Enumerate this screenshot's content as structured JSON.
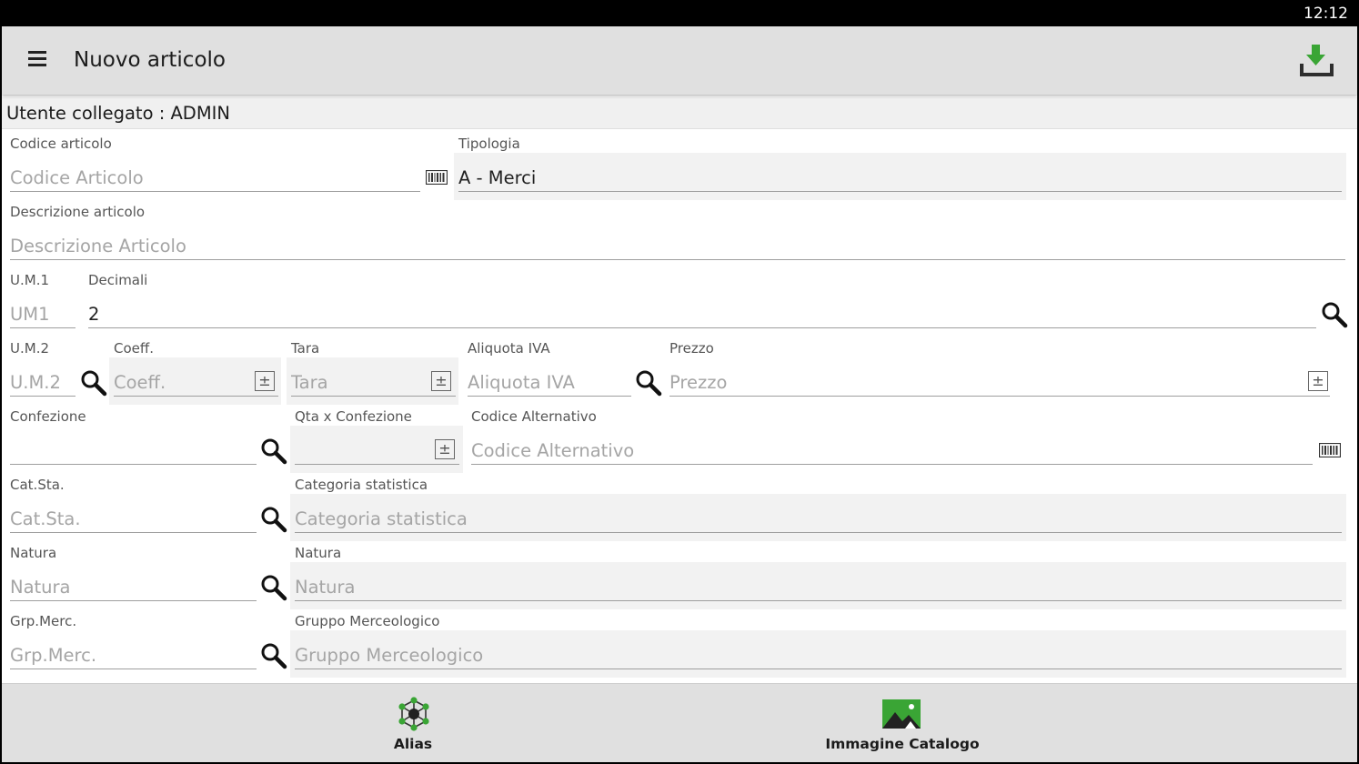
{
  "status_bar": {
    "time": "12:12"
  },
  "app_bar": {
    "title": "Nuovo articolo",
    "menu_icon": "hamburger-menu-icon",
    "save_icon": "download-save-icon"
  },
  "user_bar": {
    "text": "Utente collegato : ADMIN"
  },
  "form": {
    "codice_articolo": {
      "label": "Codice articolo",
      "placeholder": "Codice Articolo",
      "value": ""
    },
    "tipologia": {
      "label": "Tipologia",
      "value": "A - Merci"
    },
    "descrizione": {
      "label": "Descrizione articolo",
      "placeholder": "Descrizione Articolo",
      "value": ""
    },
    "um1": {
      "label": "U.M.1",
      "placeholder": "UM1",
      "value": ""
    },
    "decimali": {
      "label": "Decimali",
      "value": "2"
    },
    "um2": {
      "label": "U.M.2",
      "placeholder": "U.M.2",
      "value": ""
    },
    "coeff": {
      "label": "Coeff.",
      "placeholder": "Coeff.",
      "value": ""
    },
    "tara": {
      "label": "Tara",
      "placeholder": "Tara",
      "value": ""
    },
    "aliquota_iva": {
      "label": "Aliquota IVA",
      "placeholder": "Aliquota IVA",
      "value": ""
    },
    "prezzo": {
      "label": "Prezzo",
      "placeholder": "Prezzo",
      "value": ""
    },
    "confezione": {
      "label": "Confezione",
      "placeholder": "",
      "value": ""
    },
    "qta_confezione": {
      "label": "Qta x Confezione",
      "placeholder": "",
      "value": ""
    },
    "codice_alternativo": {
      "label": "Codice Alternativo",
      "placeholder": "Codice Alternativo",
      "value": ""
    },
    "cat_sta": {
      "label": "Cat.Sta.",
      "placeholder": "Cat.Sta.",
      "value": ""
    },
    "categoria_statistica": {
      "label": "Categoria statistica",
      "placeholder": "Categoria statistica",
      "value": ""
    },
    "natura_code": {
      "label": "Natura",
      "placeholder": "Natura",
      "value": ""
    },
    "natura_desc": {
      "label": "Natura",
      "placeholder": "Natura",
      "value": ""
    },
    "grp_merc": {
      "label": "Grp.Merc.",
      "placeholder": "Grp.Merc.",
      "value": ""
    },
    "gruppo_merceologico": {
      "label": "Gruppo Merceologico",
      "placeholder": "Gruppo Merceologico",
      "value": ""
    },
    "plus_minus_symbol": "±"
  },
  "bottom_bar": {
    "alias": {
      "label": "Alias",
      "icon": "alias-network-icon"
    },
    "immagine": {
      "label": "Immagine Catalogo",
      "icon": "catalog-image-icon"
    }
  },
  "colors": {
    "accent_green": "#3aa535",
    "app_bar": "#e0e0e0",
    "readonly_bg": "#f2f2f2"
  }
}
